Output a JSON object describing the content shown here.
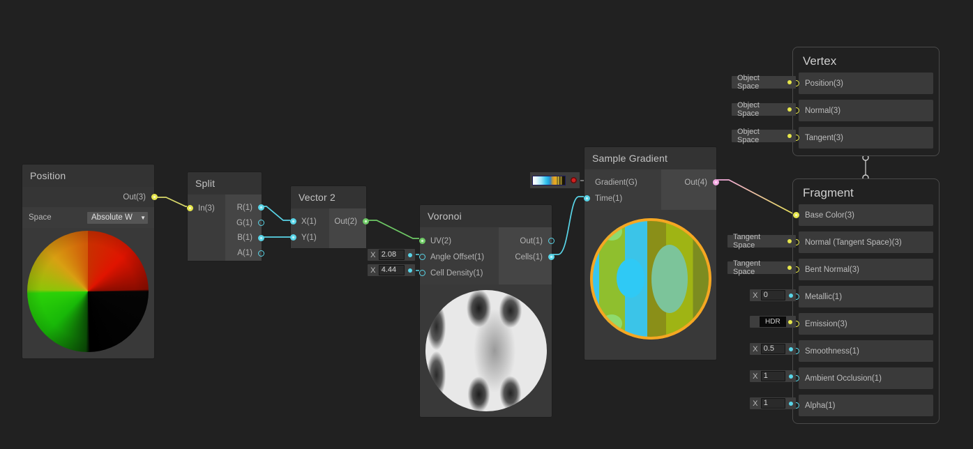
{
  "canvas": {
    "background": "#212121"
  },
  "nodes": {
    "position": {
      "title": "Position",
      "out_label": "Out(3)",
      "space_label": "Space",
      "space_value": "Absolute W",
      "preview": "sphere-position-quadrants"
    },
    "split": {
      "title": "Split",
      "in_label": "In(3)",
      "outputs": [
        "R(1)",
        "G(1)",
        "B(1)",
        "A(1)"
      ]
    },
    "vector2": {
      "title": "Vector 2",
      "inputs": [
        "X(1)",
        "Y(1)"
      ],
      "out_label": "Out(2)"
    },
    "voronoi": {
      "title": "Voronoi",
      "inputs": [
        "UV(2)",
        "Angle Offset(1)",
        "Cell Density(1)"
      ],
      "outputs": [
        "Out(1)",
        "Cells(1)"
      ],
      "angle_offset": {
        "axis": "X",
        "value": "2.08"
      },
      "cell_density": {
        "axis": "X",
        "value": "4.44"
      },
      "preview": "sphere-voronoi-grayscale"
    },
    "sample_gradient": {
      "title": "Sample Gradient",
      "inputs": [
        "Gradient(G)",
        "Time(1)"
      ],
      "out_label": "Out(4)",
      "gradient_stops": [
        "#ffffff",
        "#bdf0fb",
        "#3fc8f0",
        "#1a9fd8",
        "#2e74b5",
        "#c9a84a",
        "#f5a623",
        "#e8c33a",
        "#6b5a20",
        "#2b2416"
      ],
      "preview": "sphere-gradient-colored"
    },
    "vertex": {
      "title": "Vertex",
      "blocks": [
        {
          "label": "Position(3)",
          "value": "Object Space",
          "type": "dropdown"
        },
        {
          "label": "Normal(3)",
          "value": "Object Space",
          "type": "dropdown"
        },
        {
          "label": "Tangent(3)",
          "value": "Object Space",
          "type": "dropdown"
        }
      ]
    },
    "fragment": {
      "title": "Fragment",
      "blocks": [
        {
          "label": "Base Color(3)",
          "value": "",
          "type": "connected"
        },
        {
          "label": "Normal (Tangent Space)(3)",
          "value": "Tangent Space",
          "type": "dropdown"
        },
        {
          "label": "Bent Normal(3)",
          "value": "Tangent Space",
          "type": "dropdown"
        },
        {
          "label": "Metallic(1)",
          "value": "0",
          "axis": "X",
          "type": "float"
        },
        {
          "label": "Emission(3)",
          "value": "HDR",
          "type": "hdr"
        },
        {
          "label": "Smoothness(1)",
          "value": "0.5",
          "axis": "X",
          "type": "float"
        },
        {
          "label": "Ambient Occlusion(1)",
          "value": "1",
          "axis": "X",
          "type": "float"
        },
        {
          "label": "Alpha(1)",
          "value": "1",
          "axis": "X",
          "type": "float"
        }
      ]
    }
  },
  "edges": [
    {
      "from": "position.Out(3)",
      "to": "split.In(3)",
      "color": "#e6e64b"
    },
    {
      "from": "split.R(1)",
      "to": "vector2.X(1)",
      "color": "#59d5e8"
    },
    {
      "from": "split.B(1)",
      "to": "vector2.Y(1)",
      "color": "#59d5e8"
    },
    {
      "from": "vector2.Out(2)",
      "to": "voronoi.UV(2)",
      "color": "#6ec965"
    },
    {
      "from": "voronoi.Cells(1)",
      "to": "sample_gradient.Time(1)",
      "color": "#59d5e8"
    },
    {
      "from": "sample_gradient.Out(4)",
      "to": "fragment.Base Color(3)",
      "color": "#f2a8e0"
    }
  ]
}
